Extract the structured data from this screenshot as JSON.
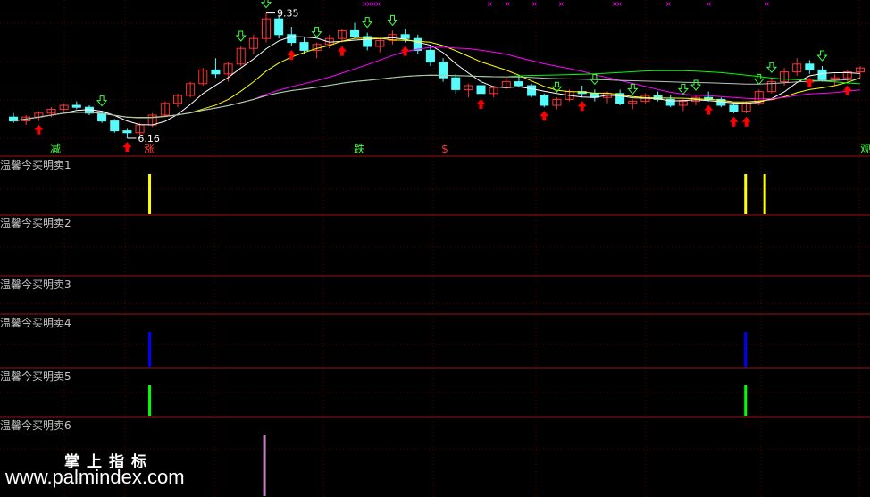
{
  "chart_data": {
    "type": "candlestick",
    "price_markers": {
      "high_label": "9.35",
      "low_label": "6.16"
    },
    "signal_labels": [
      "减",
      "涨",
      "跌",
      "$",
      "观"
    ],
    "candles": [
      [
        6.7,
        6.8,
        6.55,
        6.6
      ],
      [
        6.6,
        6.75,
        6.5,
        6.7
      ],
      [
        6.7,
        6.85,
        6.6,
        6.8
      ],
      [
        6.8,
        6.95,
        6.7,
        6.9
      ],
      [
        6.9,
        7.05,
        6.85,
        7.0
      ],
      [
        7.0,
        7.1,
        6.9,
        6.95
      ],
      [
        6.95,
        7.0,
        6.75,
        6.8
      ],
      [
        6.8,
        6.85,
        6.55,
        6.6
      ],
      [
        6.6,
        6.65,
        6.3,
        6.35
      ],
      [
        6.35,
        6.4,
        6.16,
        6.3
      ],
      [
        6.3,
        6.55,
        6.25,
        6.5
      ],
      [
        6.5,
        6.8,
        6.45,
        6.75
      ],
      [
        6.75,
        7.1,
        6.7,
        7.05
      ],
      [
        7.05,
        7.3,
        6.95,
        7.25
      ],
      [
        7.25,
        7.6,
        7.2,
        7.55
      ],
      [
        7.55,
        7.95,
        7.5,
        7.9
      ],
      [
        7.9,
        8.2,
        7.7,
        7.8
      ],
      [
        7.8,
        8.1,
        7.6,
        8.05
      ],
      [
        8.05,
        8.5,
        8.0,
        8.45
      ],
      [
        8.45,
        8.8,
        8.3,
        8.7
      ],
      [
        8.7,
        9.35,
        8.6,
        9.2
      ],
      [
        9.2,
        9.3,
        8.7,
        8.8
      ],
      [
        8.8,
        9.0,
        8.5,
        8.6
      ],
      [
        8.6,
        8.75,
        8.3,
        8.4
      ],
      [
        8.4,
        8.6,
        8.2,
        8.55
      ],
      [
        8.55,
        8.8,
        8.45,
        8.7
      ],
      [
        8.7,
        8.95,
        8.6,
        8.9
      ],
      [
        8.9,
        9.1,
        8.7,
        8.75
      ],
      [
        8.75,
        8.85,
        8.4,
        8.5
      ],
      [
        8.5,
        8.7,
        8.35,
        8.65
      ],
      [
        8.65,
        8.9,
        8.55,
        8.8
      ],
      [
        8.8,
        8.95,
        8.6,
        8.7
      ],
      [
        8.7,
        8.8,
        8.3,
        8.4
      ],
      [
        8.4,
        8.5,
        8.0,
        8.1
      ],
      [
        8.1,
        8.2,
        7.6,
        7.7
      ],
      [
        7.7,
        7.8,
        7.3,
        7.4
      ],
      [
        7.4,
        7.55,
        7.2,
        7.5
      ],
      [
        7.5,
        7.6,
        7.25,
        7.3
      ],
      [
        7.3,
        7.5,
        7.2,
        7.45
      ],
      [
        7.45,
        7.7,
        7.4,
        7.6
      ],
      [
        7.6,
        7.75,
        7.45,
        7.5
      ],
      [
        7.5,
        7.55,
        7.2,
        7.25
      ],
      [
        7.25,
        7.3,
        6.95,
        7.0
      ],
      [
        7.0,
        7.2,
        6.9,
        7.15
      ],
      [
        7.15,
        7.4,
        7.1,
        7.35
      ],
      [
        7.35,
        7.5,
        7.2,
        7.3
      ],
      [
        7.3,
        7.4,
        7.1,
        7.2
      ],
      [
        7.2,
        7.35,
        7.05,
        7.3
      ],
      [
        7.3,
        7.4,
        7.0,
        7.05
      ],
      [
        7.05,
        7.15,
        6.9,
        7.1
      ],
      [
        7.1,
        7.3,
        7.05,
        7.25
      ],
      [
        7.25,
        7.35,
        7.1,
        7.15
      ],
      [
        7.15,
        7.25,
        6.95,
        7.0
      ],
      [
        7.0,
        7.15,
        6.85,
        7.1
      ],
      [
        7.1,
        7.25,
        7.0,
        7.2
      ],
      [
        7.2,
        7.35,
        7.1,
        7.15
      ],
      [
        7.15,
        7.2,
        6.95,
        7.0
      ],
      [
        7.0,
        7.05,
        6.8,
        6.85
      ],
      [
        6.85,
        7.1,
        6.8,
        7.05
      ],
      [
        7.05,
        7.4,
        7.0,
        7.35
      ],
      [
        7.35,
        7.7,
        7.3,
        7.6
      ],
      [
        7.6,
        7.95,
        7.5,
        7.85
      ],
      [
        7.85,
        8.2,
        7.75,
        8.05
      ],
      [
        8.05,
        8.15,
        7.8,
        7.9
      ],
      [
        7.9,
        8.0,
        7.6,
        7.65
      ],
      [
        7.65,
        7.8,
        7.5,
        7.7
      ],
      [
        7.7,
        7.9,
        7.6,
        7.85
      ],
      [
        7.85,
        8.0,
        7.7,
        7.95
      ]
    ],
    "indicator_panels": [
      {
        "label": "温馨今买明卖1",
        "color": "#ffff00",
        "signals": [
          0.172,
          0.857,
          0.879
        ]
      },
      {
        "label": "温馨今买明卖2",
        "color": "#ffff00",
        "signals": []
      },
      {
        "label": "温馨今买明卖3",
        "color": "#ffff00",
        "signals": []
      },
      {
        "label": "温馨今买明卖4",
        "color": "#0000ff",
        "signals": [
          0.172,
          0.857
        ]
      },
      {
        "label": "温馨今买明卖5",
        "color": "#00ff00",
        "signals": [
          0.172,
          0.857
        ]
      },
      {
        "label": "温馨今买明卖6",
        "color": "#c080c0",
        "signals": [
          0.304
        ]
      }
    ],
    "colors": {
      "up": "#ff3232",
      "down": "#54fcfc",
      "ma5": "#ffffff",
      "ma10": "#ffff00",
      "ma20": "#ff00ff",
      "ma60": "#00ff00",
      "ma120": "#c0c0c0",
      "separator": "#a01010",
      "grid": "#5a0000"
    }
  },
  "watermark": {
    "name": "掌上指标",
    "url": "www.palmindex.com"
  }
}
